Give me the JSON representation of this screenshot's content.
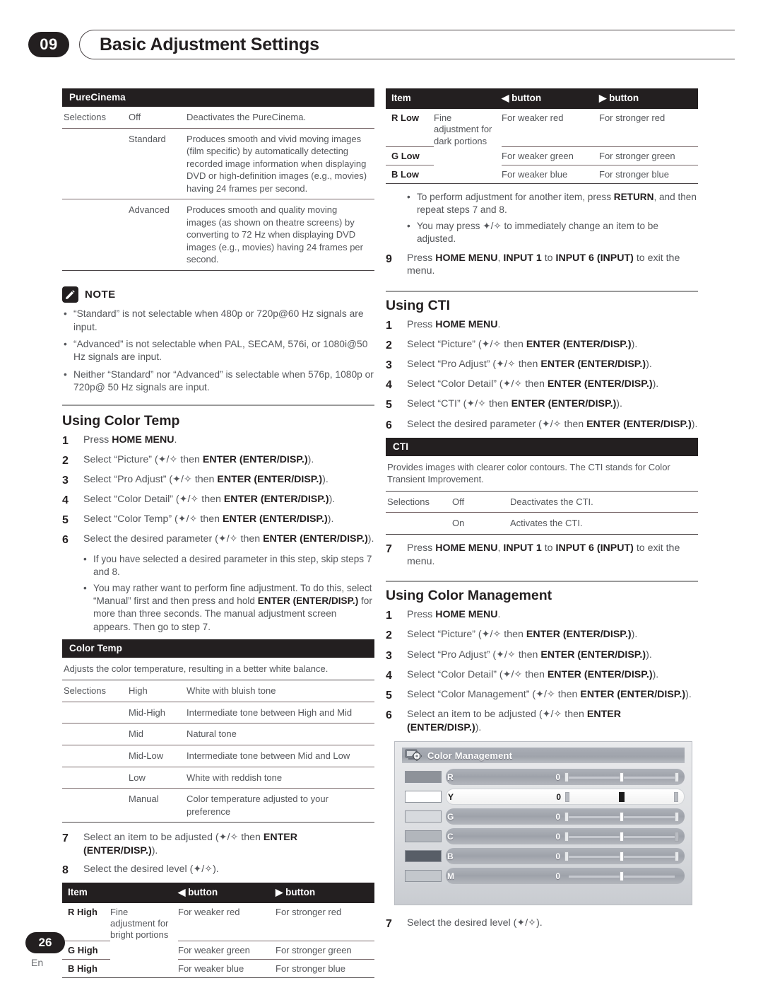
{
  "header": {
    "chapter_number": "09",
    "chapter_title": "Basic Adjustment Settings"
  },
  "footer": {
    "page_number": "26",
    "language": "En"
  },
  "left_column": {
    "purecinema_table": {
      "title": "PureCinema",
      "selections_label": "Selections",
      "rows": [
        {
          "option": "Off",
          "description": "Deactivates the PureCinema."
        },
        {
          "option": "Standard",
          "description": "Produces smooth and vivid moving images (film specific) by automatically detecting recorded image information when displaying DVD or high-definition images (e.g., movies) having 24 frames per second."
        },
        {
          "option": "Advanced",
          "description": "Produces smooth and quality moving images (as shown on theatre screens) by converting to 72 Hz when displaying DVD images (e.g., movies) having 24 frames per second."
        }
      ]
    },
    "note": {
      "label": "NOTE",
      "icon": "pencil-icon",
      "items": [
        "“Standard” is not selectable when 480p or 720p@60 Hz signals are input.",
        "“Advanced” is not selectable when PAL, SECAM, 576i, or 1080i@50 Hz signals are input.",
        "Neither “Standard” nor “Advanced” is selectable when 576p, 1080p or 720p@ 50 Hz signals are input."
      ]
    },
    "using_color_temp": {
      "title": "Using Color Temp",
      "steps": [
        {
          "n": "1",
          "pre": "Press ",
          "bold": "HOME MENU",
          "post": "."
        },
        {
          "n": "2",
          "pre": "Select “Picture” (✦/✧ then ",
          "bold": "ENTER (ENTER/DISP.)",
          "post": ")."
        },
        {
          "n": "3",
          "pre": "Select “Pro Adjust” (✦/✧ then ",
          "bold": "ENTER (ENTER/DISP.)",
          "post": ")."
        },
        {
          "n": "4",
          "pre": "Select “Color Detail” (✦/✧ then ",
          "bold": "ENTER (ENTER/DISP.)",
          "post": ")."
        },
        {
          "n": "5",
          "pre": "Select “Color Temp” (✦/✧ then ",
          "bold": "ENTER (ENTER/DISP.)",
          "post": ")."
        },
        {
          "n": "6",
          "pre": "Select the desired parameter (✦/✧ then ",
          "bold": "ENTER (ENTER/DISP.)",
          "post": ")."
        }
      ],
      "bullets": [
        {
          "pre": "If you have selected a desired parameter in this step, skip steps 7 and 8.",
          "bold": "",
          "post": ""
        },
        {
          "pre": "You may rather want to perform fine adjustment. To do this, select “Manual” first and then press and hold ",
          "bold": "ENTER (ENTER/DISP.)",
          "post": " for more than three seconds. The manual adjustment screen appears. Then go to step 7."
        }
      ],
      "color_temp_table": {
        "title": "Color Temp",
        "description": "Adjusts the color temperature, resulting in a better white balance.",
        "selections_label": "Selections",
        "rows": [
          {
            "option": "High",
            "description": "White with bluish tone"
          },
          {
            "option": "Mid-High",
            "description": "Intermediate tone between High and Mid"
          },
          {
            "option": "Mid",
            "description": "Natural tone"
          },
          {
            "option": "Mid-Low",
            "description": "Intermediate tone between Mid and Low"
          },
          {
            "option": "Low",
            "description": "White with reddish tone"
          },
          {
            "option": "Manual",
            "description": "Color temperature adjusted to your preference"
          }
        ]
      },
      "steps_after": [
        {
          "n": "7",
          "pre": "Select an item to be adjusted (✦/✧ then ",
          "bold": "ENTER (ENTER/DISP.)",
          "post": ")."
        },
        {
          "n": "8",
          "pre": "Select the desired level (✦/✧).",
          "bold": "",
          "post": ""
        }
      ],
      "item_table": {
        "headers": [
          "Item",
          "",
          "◀ button",
          "▶ button"
        ],
        "group_note": "Fine adjustment for bright portions",
        "rows": [
          {
            "item": "R High",
            "left": "For weaker red",
            "right": "For stronger red"
          },
          {
            "item": "G High",
            "left": "For weaker green",
            "right": "For stronger green"
          },
          {
            "item": "B High",
            "left": "For weaker blue",
            "right": "For stronger blue"
          }
        ]
      }
    }
  },
  "right_column": {
    "item_table_low": {
      "headers": [
        "Item",
        "",
        "◀ button",
        "▶ button"
      ],
      "group_note": "Fine adjustment for dark portions",
      "rows": [
        {
          "item": "R Low",
          "left": "For weaker red",
          "right": "For stronger red"
        },
        {
          "item": "G Low",
          "left": "For weaker green",
          "right": "For stronger green"
        },
        {
          "item": "B Low",
          "left": "For weaker blue",
          "right": "For stronger blue"
        }
      ]
    },
    "top_bullets": [
      {
        "pre": "To perform adjustment for another item, press ",
        "bold": "RETURN",
        "post": ", and then repeat steps 7 and 8."
      },
      {
        "pre": "You may press ✦/✧ to immediately change an item to be adjusted.",
        "bold": "",
        "post": ""
      }
    ],
    "step9": {
      "n": "9",
      "pre": "Press ",
      "bold": "HOME MENU",
      "mid": ", ",
      "bold2": "INPUT 1",
      "mid2": " to ",
      "bold3": "INPUT 6 (INPUT)",
      "post": " to exit the menu."
    },
    "using_cti": {
      "title": "Using CTI",
      "steps": [
        {
          "n": "1",
          "pre": "Press ",
          "bold": "HOME MENU",
          "post": "."
        },
        {
          "n": "2",
          "pre": "Select “Picture” (✦/✧ then ",
          "bold": "ENTER (ENTER/DISP.)",
          "post": ")."
        },
        {
          "n": "3",
          "pre": "Select “Pro Adjust” (✦/✧ then ",
          "bold": "ENTER (ENTER/DISP.)",
          "post": ")."
        },
        {
          "n": "4",
          "pre": "Select “Color Detail” (✦/✧ then ",
          "bold": "ENTER (ENTER/DISP.)",
          "post": ")."
        },
        {
          "n": "5",
          "pre": "Select “CTI” (✦/✧ then ",
          "bold": "ENTER (ENTER/DISP.)",
          "post": ")."
        },
        {
          "n": "6",
          "pre": "Select the desired parameter (✦/✧ then ",
          "bold": "ENTER (ENTER/DISP.)",
          "post": ")."
        }
      ],
      "cti_table": {
        "title": "CTI",
        "description": "Provides images with clearer color contours. The CTI stands for Color Transient Improvement.",
        "selections_label": "Selections",
        "rows": [
          {
            "option": "Off",
            "description": "Deactivates the CTI."
          },
          {
            "option": "On",
            "description": "Activates the CTI."
          }
        ]
      },
      "step7": {
        "n": "7",
        "pre": "Press ",
        "bold": "HOME MENU",
        "mid": ", ",
        "bold2": "INPUT 1",
        "mid2": " to ",
        "bold3": "INPUT 6 (INPUT)",
        "post": " to exit the menu."
      }
    },
    "using_color_management": {
      "title": "Using Color Management",
      "steps": [
        {
          "n": "1",
          "pre": "Press ",
          "bold": "HOME MENU",
          "post": "."
        },
        {
          "n": "2",
          "pre": "Select “Picture” (✦/✧ then ",
          "bold": "ENTER (ENTER/DISP.)",
          "post": ")."
        },
        {
          "n": "3",
          "pre": "Select “Pro Adjust” (✦/✧ then ",
          "bold": "ENTER (ENTER/DISP.)",
          "post": ")."
        },
        {
          "n": "4",
          "pre": "Select “Color Detail” (✦/✧ then ",
          "bold": "ENTER (ENTER/DISP.)",
          "post": ")."
        },
        {
          "n": "5",
          "pre": "Select “Color Management” (✦/✧ then ",
          "bold": "ENTER (ENTER/DISP.)",
          "post": ")."
        },
        {
          "n": "6",
          "pre": "Select an item to be adjusted (✦/✧ then ",
          "bold": "ENTER (ENTER/DISP.)",
          "post": ")."
        }
      ],
      "osd": {
        "title": "Color Management",
        "icon": "display-settings-icon",
        "rows": [
          {
            "label": "R",
            "value": "0",
            "selected": false,
            "swatch": "#8e9299"
          },
          {
            "label": "Y",
            "value": "0",
            "selected": true,
            "swatch": "#ffffff"
          },
          {
            "label": "G",
            "value": "0",
            "selected": false,
            "swatch": "#d7dade"
          },
          {
            "label": "C",
            "value": "0",
            "selected": false,
            "swatch": "#b2b6bc"
          },
          {
            "label": "B",
            "value": "0",
            "selected": false,
            "swatch": "#585e67"
          },
          {
            "label": "M",
            "value": "0",
            "selected": false,
            "swatch": "#c3c7cc"
          }
        ]
      },
      "step7": {
        "n": "7",
        "pre": "Select the desired level (✦/✧).",
        "bold": "",
        "post": ""
      }
    }
  }
}
